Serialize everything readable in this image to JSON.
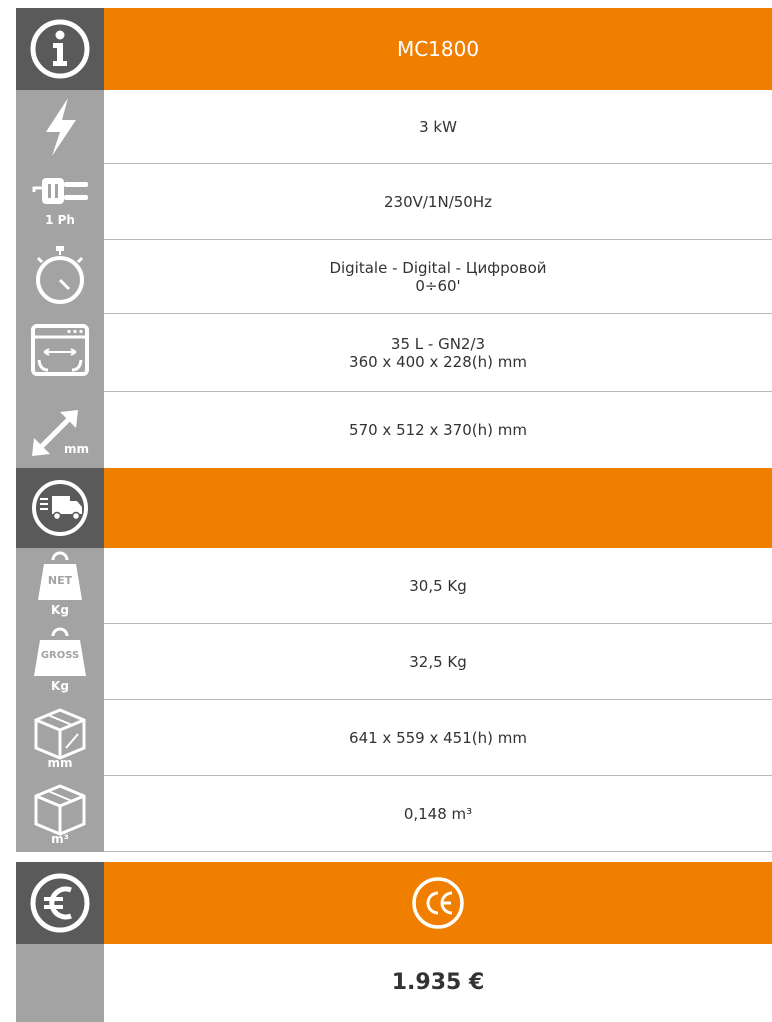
{
  "model": "MC1800",
  "specs": {
    "power": "3 kW",
    "phase_label": "1 Ph",
    "voltage": "230V/1N/50Hz",
    "timer_line1": "Digitale - Digital - Цифровой",
    "timer_line2": "0÷60'",
    "chamber_line1": "35 L - GN2/3",
    "chamber_line2": "360 x 400 x 228(h) mm",
    "dims_unit": "mm",
    "external_dims": "570 x 512 x 370(h) mm"
  },
  "shipping": {
    "net_label": "NET",
    "net_unit": "Kg",
    "net_weight": "30,5 Kg",
    "gross_label": "GROSS",
    "gross_unit": "Kg",
    "gross_weight": "32,5 Kg",
    "pack_unit": "mm",
    "pack_dims": "641 x 559 x 451(h) mm",
    "volume_unit": "m³",
    "volume": "0,148 m³"
  },
  "price": "1.935 €",
  "colors": {
    "orange": "#f07f00",
    "dark_gray": "#5a5a5a",
    "mid_gray": "#a3a3a3"
  },
  "icons": [
    "info-icon",
    "lightning-icon",
    "plug-icon",
    "stopwatch-icon",
    "oven-chamber-icon",
    "dimensions-arrow-icon",
    "delivery-truck-icon",
    "net-weight-icon",
    "gross-weight-icon",
    "package-dims-icon",
    "package-volume-icon",
    "euro-icon",
    "ce-mark-icon"
  ]
}
